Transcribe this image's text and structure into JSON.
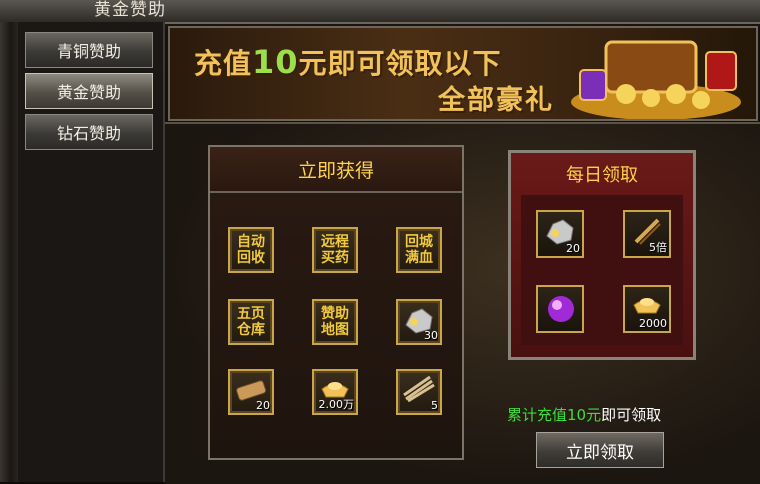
{
  "window": {
    "title": "黄金赞助"
  },
  "sidebar": {
    "items": [
      {
        "label": "青铜赞助"
      },
      {
        "label": "黄金赞助"
      },
      {
        "label": "钻石赞助"
      }
    ],
    "active": "黄金赞助"
  },
  "banner": {
    "line1_prefix": "充值",
    "line1_number": "10",
    "line1_suffix": "元即可领取以下",
    "line2": "全部豪礼"
  },
  "instant_panel": {
    "title": "立即获得",
    "slots": [
      {
        "label": "自动\n回收",
        "icon": "text-tile"
      },
      {
        "label": "远程\n买药",
        "icon": "text-tile"
      },
      {
        "label": "回城\n满血",
        "icon": "text-tile"
      },
      {
        "label": "五页\n仓库",
        "icon": "text-tile"
      },
      {
        "label": "赞助\n地图",
        "icon": "text-tile"
      },
      {
        "qty": "30",
        "icon": "silver-ore-icon"
      },
      {
        "qty": "20",
        "icon": "scroll-icon"
      },
      {
        "qty": "2.00万",
        "icon": "gold-ingot-icon"
      },
      {
        "qty": "5",
        "icon": "bundle-icon"
      }
    ]
  },
  "daily_panel": {
    "title": "每日领取",
    "slots": [
      {
        "qty": "20",
        "icon": "silver-ore-icon"
      },
      {
        "qty": "5倍",
        "icon": "multiplier-scroll-icon"
      },
      {
        "qty": "",
        "icon": "purple-orb-icon"
      },
      {
        "qty": "2000",
        "icon": "gold-ingot-icon"
      }
    ]
  },
  "footer": {
    "note_prefix": "累计充值",
    "note_amount": "10元",
    "note_suffix": "即可领取",
    "claim_label": "立即领取"
  },
  "colors": {
    "accent_gold": "#ffd24a",
    "green": "#3ddc3d",
    "panel_red": "#6a1a18"
  }
}
